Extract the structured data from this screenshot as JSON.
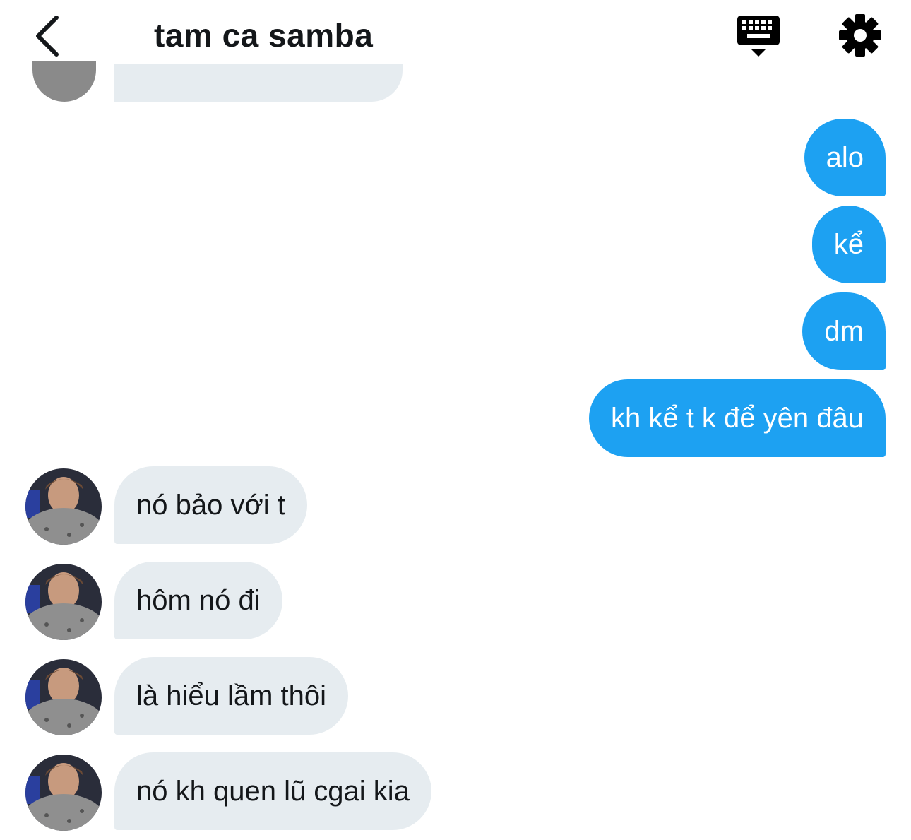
{
  "header": {
    "title": "tam ca samba",
    "back_icon": "chevron-left-icon",
    "keyboard_icon": "keyboard-icon",
    "settings_icon": "gear-icon"
  },
  "colors": {
    "outgoing_bubble": "#1da1f2",
    "incoming_bubble": "#e6ecf0",
    "title_text": "#14171a"
  },
  "messages": {
    "outgoing": [
      {
        "text": "alo"
      },
      {
        "text": "kể"
      },
      {
        "text": "dm"
      },
      {
        "text": "kh kể t k để yên đâu"
      }
    ],
    "incoming": [
      {
        "text": "nó bảo với t"
      },
      {
        "text": "hôm nó đi"
      },
      {
        "text": "là hiểu lầm thôi"
      },
      {
        "text": "nó kh quen lũ cgai kia"
      }
    ]
  }
}
